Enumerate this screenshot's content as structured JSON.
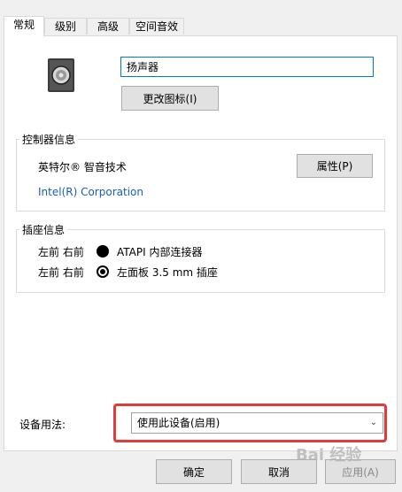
{
  "tabs": [
    {
      "label": "常规"
    },
    {
      "label": "级别"
    },
    {
      "label": "高级"
    },
    {
      "label": "空间音效"
    }
  ],
  "device": {
    "name_value": "扬声器",
    "change_icon_label": "更改图标(I)"
  },
  "controller": {
    "group_title": "控制器信息",
    "name": "英特尔® 智音技术",
    "vendor": "Intel(R) Corporation",
    "properties_label": "属性(P)"
  },
  "jack": {
    "group_title": "插座信息",
    "rows": [
      {
        "position": "左前 右前",
        "desc": "ATAPI 内部连接器"
      },
      {
        "position": "左前 右前",
        "desc": "左面板 3.5 mm 插座"
      }
    ]
  },
  "usage": {
    "label": "设备用法:",
    "selected": "使用此设备(启用)"
  },
  "footer": {
    "ok_label": "确定",
    "cancel_label": "取消",
    "apply_label": "应用(A)"
  },
  "watermark": {
    "text": "Bai 经验"
  },
  "colors": {
    "highlight": "#e03a3a",
    "input_focus": "#0078d7",
    "link": "#1a5fb4"
  }
}
